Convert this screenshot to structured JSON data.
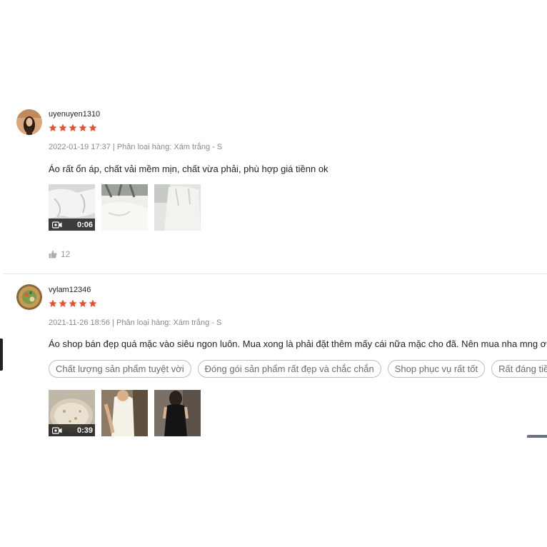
{
  "reviews": [
    {
      "username": "uyenuyen1310",
      "rating": 5,
      "date": "2022-01-19 17:37",
      "separator": "|",
      "variant": "Phân loại hàng: Xám trắng - S",
      "comment": "Áo rất ổn áp, chất vải mềm mịn, chất vừa phải, phù hợp giá tiềnn ok",
      "media": [
        {
          "type": "video",
          "duration": "0:06"
        },
        {
          "type": "image"
        },
        {
          "type": "image"
        }
      ],
      "likes": "12"
    },
    {
      "username": "vylam12346",
      "rating": 5,
      "date": "2021-11-26 18:56",
      "separator": "|",
      "variant": "Phân loại hàng: Xám trắng - S",
      "comment": "Áo shop bán đẹp quá mặc vào siêu ngon luôn. Mua xong là phải đặt thêm mấy cái nữa mặc cho đã. Nên mua nha mng ơi🥰",
      "tags": [
        "Chất lượng sản phẩm tuyệt vời",
        "Đóng gói sản phẩm rất đẹp và chắc chắn",
        "Shop phục vụ rất tốt",
        "Rất đáng tiền"
      ],
      "media": [
        {
          "type": "video",
          "duration": "0:39"
        },
        {
          "type": "image"
        },
        {
          "type": "image"
        }
      ]
    }
  ],
  "colors": {
    "star": "#ee4d2d",
    "meta_text": "#8a8a8a",
    "tag_border": "#bdbdbd"
  },
  "icons": {
    "star": "star-icon",
    "video": "video-camera-icon",
    "like": "thumbs-up-icon"
  }
}
